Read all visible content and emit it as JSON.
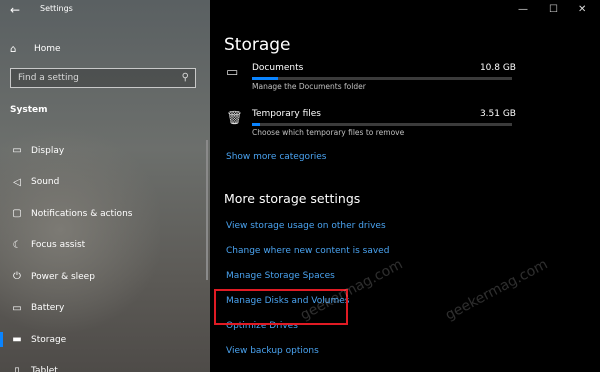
{
  "window": {
    "back_glyph": "←",
    "title": "Settings"
  },
  "sidebar": {
    "home": "Home",
    "search_placeholder": "Find a setting",
    "section": "System",
    "items": [
      {
        "label": "Display",
        "icon": "display-icon",
        "glyph": "▭"
      },
      {
        "label": "Sound",
        "icon": "sound-icon",
        "glyph": "◁"
      },
      {
        "label": "Notifications & actions",
        "icon": "notifications-icon",
        "glyph": "▢"
      },
      {
        "label": "Focus assist",
        "icon": "focus-assist-icon",
        "glyph": "☾"
      },
      {
        "label": "Power & sleep",
        "icon": "power-icon",
        "glyph": "⏻"
      },
      {
        "label": "Battery",
        "icon": "battery-icon",
        "glyph": "▭"
      },
      {
        "label": "Storage",
        "icon": "storage-icon",
        "glyph": "▬",
        "selected": true
      },
      {
        "label": "Tablet",
        "icon": "tablet-icon",
        "glyph": "▯"
      }
    ]
  },
  "main": {
    "title": "Storage",
    "storage_items": [
      {
        "name": "Documents",
        "size": "10.8 GB",
        "desc": "Manage the Documents folder",
        "usage_fraction": 0.1,
        "icon": "folder-icon"
      },
      {
        "name": "Temporary files",
        "size": "3.51 GB",
        "desc": "Choose which temporary files to remove",
        "usage_fraction": 0.03,
        "icon": "trash-icon"
      }
    ],
    "show_more": "Show more categories",
    "more_settings_title": "More storage settings",
    "links": [
      "View storage usage on other drives",
      "Change where new content is saved",
      "Manage Storage Spaces",
      "Manage Disks and Volumes",
      "Optimize Drives",
      "View backup options"
    ]
  },
  "watermark": "geekermag.com",
  "colors": {
    "accent": "#0a84ff",
    "link": "#4aa3f0",
    "highlight_box": "#e01b24"
  }
}
